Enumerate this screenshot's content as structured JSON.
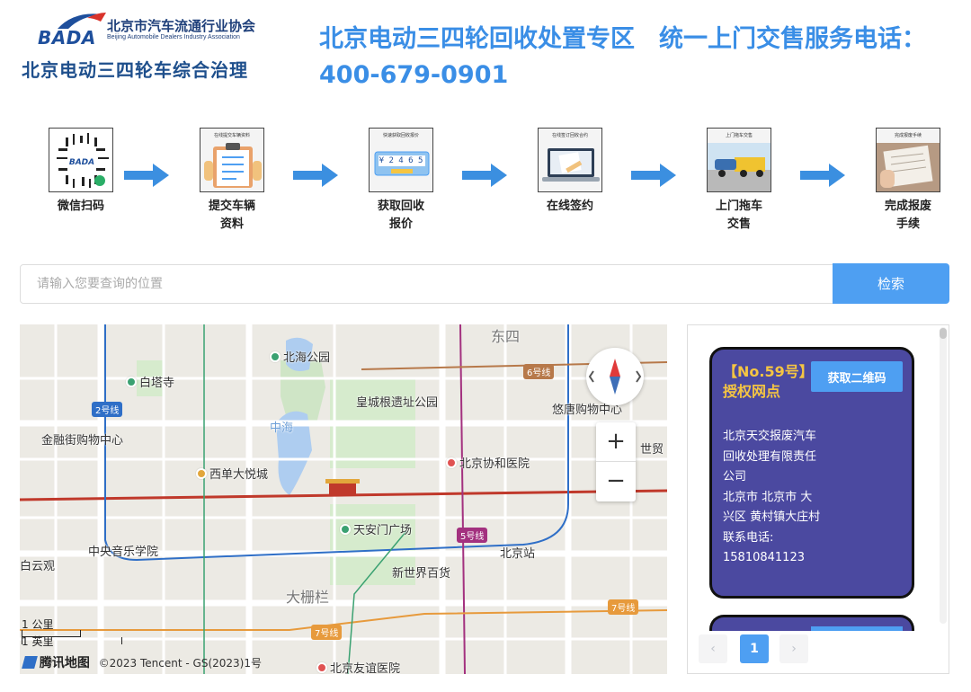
{
  "header": {
    "logo_text": "BADA",
    "association_cn": "北京市汽车流通行业协会",
    "association_en": "Beijing Automobile Dealers Industry Association",
    "subtitle": "北京电动三四轮车综合治理",
    "headline": "北京电动三四轮回收处置专区　统一上门交售服务电话：400-679-0901"
  },
  "steps": [
    {
      "label_line1": "微信扫码",
      "label_line2": "",
      "image_caption": "",
      "icon": "wechat-qr-icon"
    },
    {
      "label_line1": "提交车辆",
      "label_line2": "资料",
      "image_caption": "在线提交车辆资料",
      "icon": "clipboard-icon"
    },
    {
      "label_line1": "获取回收",
      "label_line2": "报价",
      "image_caption": "快速获取回收报价",
      "icon": "price-tag-icon",
      "price_digits": "¥ 2 4 6 5"
    },
    {
      "label_line1": "在线签约",
      "label_line2": "",
      "image_caption": "在线签订回收合约",
      "icon": "laptop-sign-icon"
    },
    {
      "label_line1": "上门拖车",
      "label_line2": "交售",
      "image_caption": "上门拖车交售",
      "icon": "tow-truck-icon"
    },
    {
      "label_line1": "完成报废",
      "label_line2": "手续",
      "image_caption": "完成报废手续",
      "icon": "certificate-icon"
    }
  ],
  "search": {
    "placeholder": "请输入您要查询的位置",
    "value": "",
    "button_label": "检索"
  },
  "map": {
    "labels": {
      "dongsi": "东四",
      "beihai": "北海公园",
      "baitasi": "白塔寺",
      "huangcheng": "皇城根遗址公园",
      "youtang": "悠唐购物中心",
      "zhonghai": "中海",
      "jinrongjie": "金融街购物中心",
      "shimao": "世贸",
      "xidan": "西单大悦城",
      "xiehe": "北京协和医院",
      "tiananmen": "天安门广场",
      "zhongyang": "中央音乐学院",
      "baiyunguan": "白云观",
      "beijingzhan": "北京站",
      "xinshijie": "新世界百货",
      "dashilan": "大栅栏",
      "youyi": "北京友谊医院"
    },
    "line_badges": {
      "line2": "2号线",
      "line6": "6号线",
      "line5": "5号线",
      "line7a": "7号线",
      "line7b": "7号线"
    },
    "zoom_in": "+",
    "zoom_out": "−",
    "scale_km": "1 公里",
    "scale_mi": "1 英里",
    "attribution_brand": "腾讯地图",
    "attribution_text": "©2023 Tencent - GS(2023)1号"
  },
  "panel": {
    "card": {
      "title": "【No.59号】授权网点",
      "qr_button": "获取二维码",
      "company": "北京天交报废汽车回收处理有限责任公司",
      "address": "北京市 北京市 大兴区 黄村镇大庄村",
      "phone_label": "联系电话:",
      "phone": "15810841123"
    },
    "pager": {
      "prev": "‹",
      "current": "1",
      "next": "›"
    }
  },
  "colors": {
    "headline": "#3a8ee6",
    "accent_button": "#4e9ff2",
    "card_bg": "#4b49a0",
    "card_title": "#f5c542",
    "step_arrow": "#3b8fe0"
  }
}
